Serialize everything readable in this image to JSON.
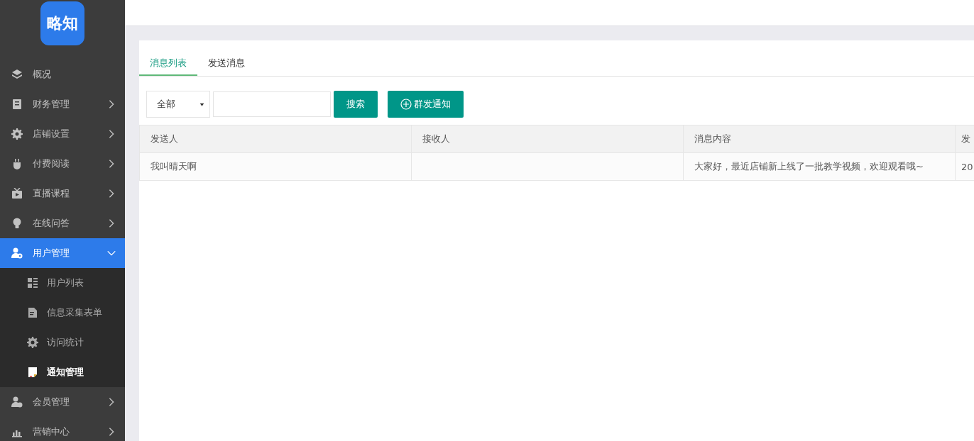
{
  "logo": {
    "text": "略知"
  },
  "sidebar": {
    "items": [
      {
        "label": "概况",
        "kind": "link",
        "selected": false
      },
      {
        "label": "财务管理",
        "kind": "group",
        "selected": false,
        "expanded": false
      },
      {
        "label": "店铺设置",
        "kind": "group",
        "selected": false,
        "expanded": false
      },
      {
        "label": "付费阅读",
        "kind": "group",
        "selected": false,
        "expanded": false
      },
      {
        "label": "直播课程",
        "kind": "group",
        "selected": false,
        "expanded": false
      },
      {
        "label": "在线问答",
        "kind": "group",
        "selected": false,
        "expanded": false
      },
      {
        "label": "用户管理",
        "kind": "group",
        "selected": true,
        "expanded": true,
        "children": [
          {
            "label": "用户列表",
            "selected": false
          },
          {
            "label": "信息采集表单",
            "selected": false
          },
          {
            "label": "访问统计",
            "selected": false
          },
          {
            "label": "通知管理",
            "selected": true
          }
        ]
      },
      {
        "label": "会员管理",
        "kind": "group",
        "selected": false,
        "expanded": false
      },
      {
        "label": "营销中心",
        "kind": "group",
        "selected": false,
        "expanded": false
      }
    ]
  },
  "tabs": [
    {
      "label": "消息列表",
      "selected": true
    },
    {
      "label": "发送消息",
      "selected": false
    }
  ],
  "filter": {
    "value": "全部"
  },
  "search_button": "搜索",
  "broadcast_button": "群发通知",
  "table": {
    "columns": [
      "发送人",
      "接收人",
      "消息内容",
      "发"
    ],
    "rows": [
      [
        "我叫晴天啊",
        "",
        "大家好，最近店铺新上线了一批教学视频，欢迎观看哦~",
        "20"
      ]
    ]
  }
}
